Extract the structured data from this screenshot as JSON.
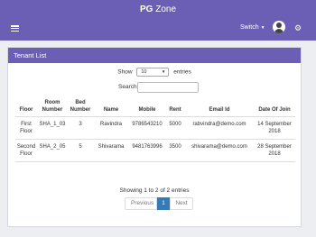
{
  "header": {
    "brand_bold": "PG",
    "brand_rest": " Zone",
    "switch_label": "Switch",
    "menu_icon": "hamburger-icon",
    "settings_icon": "gears-icon",
    "avatar_icon": "user-avatar-icon",
    "accent_color": "#6b5fb5"
  },
  "panel": {
    "title": "Tenant List",
    "show_label": "Show",
    "entries_value": "10",
    "entries_label": "entries",
    "search_label": "Search:",
    "search_value": ""
  },
  "table": {
    "columns": [
      "Floor",
      "Room Number",
      "Bed Number",
      "Name",
      "Mobile",
      "Rent",
      "Email Id",
      "Date Of Join"
    ],
    "rows": [
      [
        "First Floor",
        "SHA_1_03",
        "3",
        "Ravindra",
        "9786543210",
        "5000",
        "rabvindra@demo.com",
        "14 September 2018"
      ],
      [
        "Second Floor",
        "SHA_2_05",
        "5",
        "Shivarama",
        "9481763996",
        "3500",
        "shivarama@demo.com",
        "28 September 2018"
      ]
    ]
  },
  "footer": {
    "info": "Showing 1 to 2 of 2 entries",
    "previous": "Previous",
    "current_page": "1",
    "next": "Next",
    "page_color": "#337ab7"
  }
}
